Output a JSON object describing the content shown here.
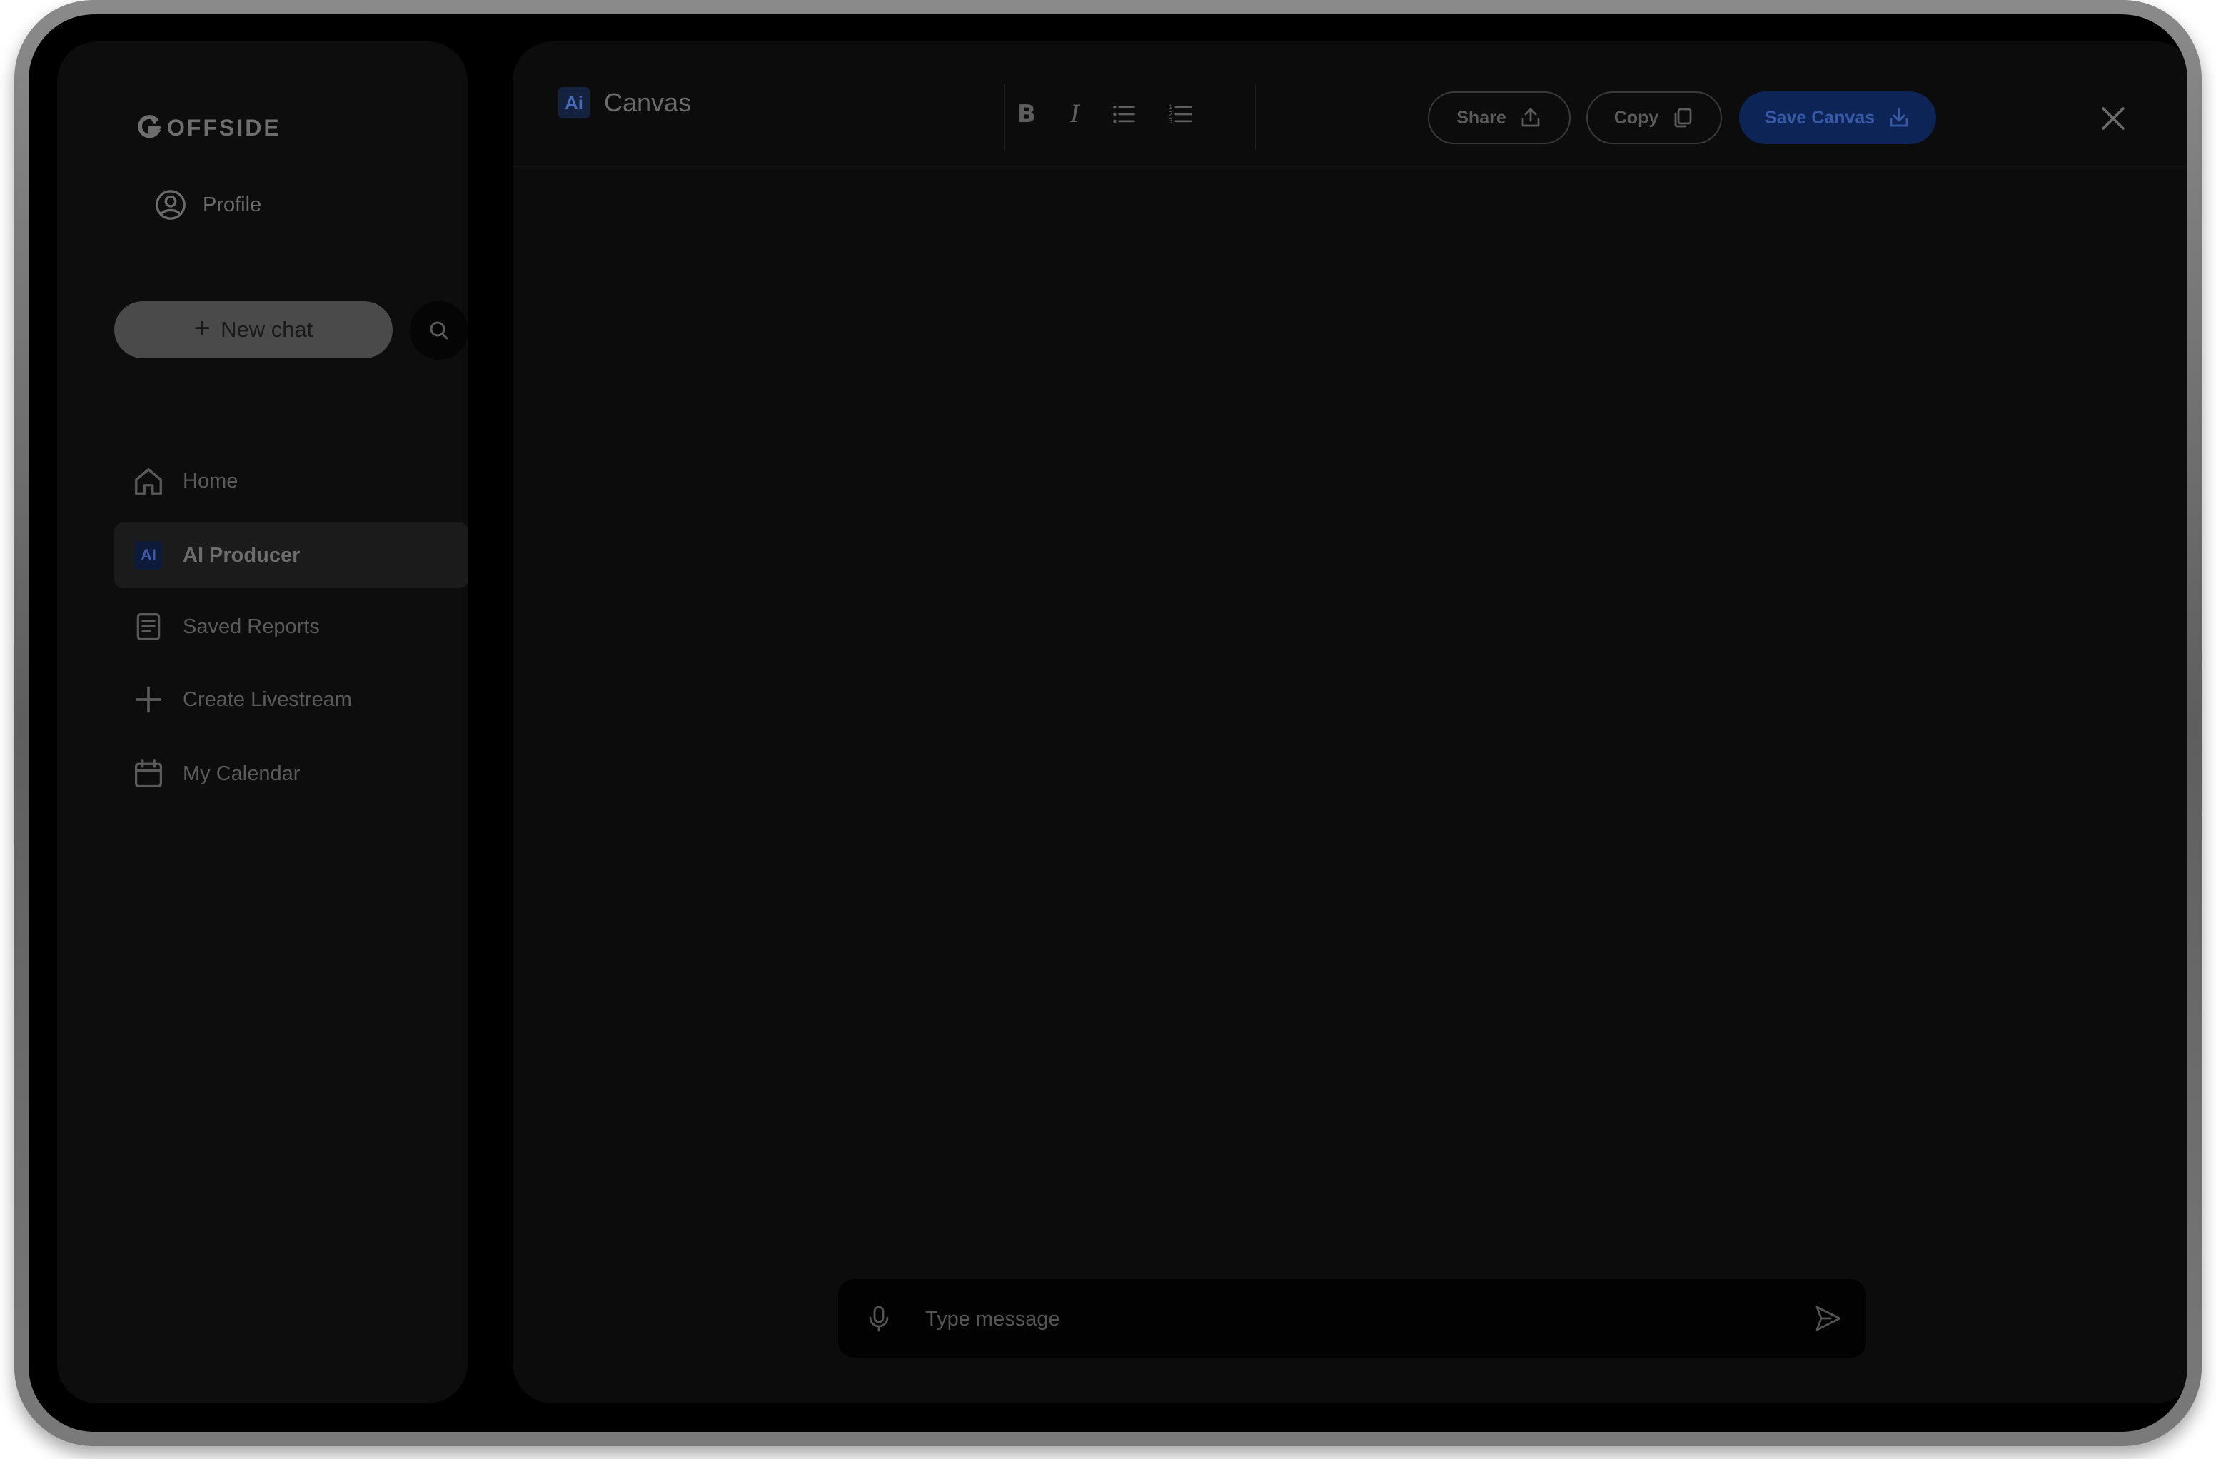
{
  "brand": {
    "logo_text": "OFFSIDE"
  },
  "sidebar": {
    "profile_label": "Profile",
    "new_chat_label": "New chat",
    "items": [
      {
        "label": "Home",
        "icon": "home-icon",
        "active": false
      },
      {
        "label": "AI Producer",
        "icon": "ai-icon",
        "badge": "AI",
        "active": true
      },
      {
        "label": "Saved Reports",
        "icon": "document-icon",
        "active": false
      },
      {
        "label": "Create Livestream",
        "icon": "plus-icon",
        "active": false
      },
      {
        "label": "My Calendar",
        "icon": "calendar-icon",
        "active": false
      }
    ]
  },
  "canvas": {
    "badge": "Ai",
    "title": "Canvas",
    "format_bold": "B",
    "format_italic": "I",
    "share_label": "Share",
    "copy_label": "Copy",
    "save_label": "Save Canvas"
  },
  "composer": {
    "placeholder": "Type message",
    "value": ""
  },
  "colors": {
    "accent_save": "#0d2456",
    "accent_ai_badge": "#142240",
    "panel_bg": "#0c0c0c",
    "screen_bg": "#000000"
  }
}
